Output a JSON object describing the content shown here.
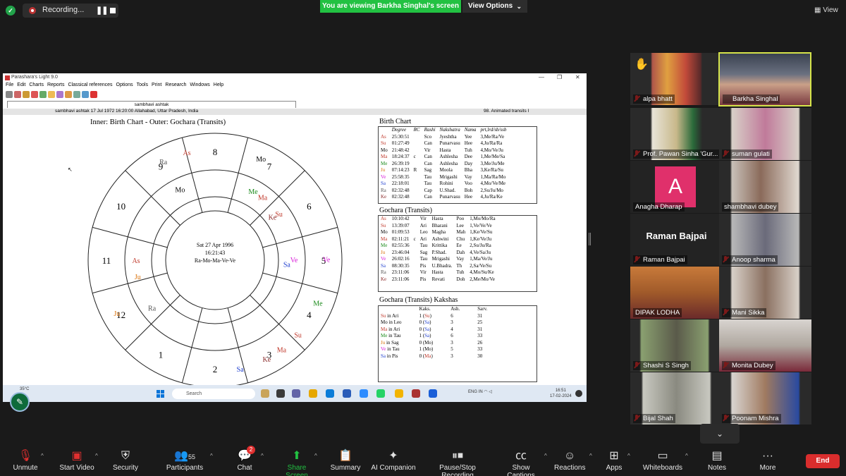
{
  "top": {
    "recording_label": "Recording...",
    "viewing_banner": "You are viewing Barkha Singhal's screen",
    "view_options_label": "View Options",
    "view_label": "View"
  },
  "app": {
    "window_title": "Parashara's Light 9.0",
    "menu": [
      "File",
      "Edit",
      "Charts",
      "Reports",
      "Classical references",
      "Options",
      "Tools",
      "Print",
      "Research",
      "Windows",
      "Help"
    ],
    "tab_label": "sambhavi ashtak",
    "info_left": "sambhavi ashtak 17 Jul 1972 16:20:00  Allahabad, Uttar Pradesh, India",
    "info_right": "98. Animated transits I",
    "chart_title": "Inner: Birth Chart - Outer: Gochara (Transits)",
    "wheel_center": [
      "Sat 27 Apr 1996",
      "16:21:43",
      "Ra-Mo-Ma-Ve-Ve"
    ],
    "house_numbers": [
      "1",
      "2",
      "3",
      "4",
      "5",
      "6",
      "7",
      "8",
      "9",
      "10",
      "11",
      "12"
    ],
    "birth_chart": {
      "title": "Birth Chart",
      "headers": [
        "",
        "Degree",
        "RC",
        "Rashi",
        "Nakshatra",
        "Nama",
        "prt,lrd/sb/ssb"
      ],
      "rows": [
        [
          "As",
          "25:30:51",
          "",
          "Sco",
          "Jyeshtha",
          "Yee",
          "3,Me/Ra/Ve"
        ],
        [
          "Su",
          "01:27:49",
          "",
          "Can",
          "Punarvasu",
          "Hee",
          "4,Ju/Ra/Ra"
        ],
        [
          "Mo",
          "21:48:42",
          "",
          "Vir",
          "Hasta",
          "Tuh",
          "4,Mo/Ve/Ju"
        ],
        [
          "Ma",
          "18:24:37",
          "c",
          "Can",
          "Ashlesha",
          "Dee",
          "1,Me/Me/Sa"
        ],
        [
          "Me",
          "26:39:19",
          "",
          "Can",
          "Ashlesha",
          "Day",
          "3,Me/Ju/Me"
        ],
        [
          "Ju",
          "07:14:23",
          "R",
          "Sag",
          "Moola",
          "Bha",
          "3,Ke/Ra/Su"
        ],
        [
          "Ve",
          "25:58:35",
          "",
          "Tau",
          "Mrigashi",
          "Vay",
          "1,Ma/Ra/Mo"
        ],
        [
          "Sa",
          "22:18:01",
          "",
          "Tau",
          "Rohini",
          "Voo",
          "4,Mo/Ve/Me"
        ],
        [
          "Ra",
          "02:32:48",
          "",
          "Cap",
          "U.Shad.",
          "Boh",
          "2,Su/Ju/Mo"
        ],
        [
          "Ke",
          "02:32:48",
          "",
          "Can",
          "Punarvasu",
          "Hee",
          "4,Ju/Ra/Ke"
        ]
      ]
    },
    "gochara": {
      "title": "Gochara (Transits)",
      "rows": [
        [
          "As",
          "10:10:42",
          "",
          "Vir",
          "Hasta",
          "Poo",
          "1,Mo/Mo/Ra"
        ],
        [
          "Su",
          "13:39:07",
          "",
          "Ari",
          "Bharani",
          "Lee",
          "1,Ve/Ve/Ve"
        ],
        [
          "Mo",
          "01:09:53",
          "",
          "Leo",
          "Magha",
          "Mah",
          "1,Ke/Ve/Su"
        ],
        [
          "Ma",
          "02:11:21",
          "c",
          "Ari",
          "Ashwini",
          "Chu",
          "1,Ke/Ve/Ju"
        ],
        [
          "Me",
          "02:55:36",
          "",
          "Tau",
          "Krittika",
          "Ee",
          "2,Su/Ju/Ra"
        ],
        [
          "Ju",
          "23:46:04",
          "",
          "Sag",
          "P.Shad.",
          "Dah",
          "4,Ve/Sa/Ju"
        ],
        [
          "Ve",
          "26:02:16",
          "",
          "Tau",
          "Mrigashi",
          "Vay",
          "1,Ma/Ve/Ju"
        ],
        [
          "Sa",
          "08:30:35",
          "",
          "Pis",
          "U.Bhadra.",
          "Th",
          "2,Sa/Ve/Su"
        ],
        [
          "Ra",
          "23:11:06",
          "",
          "Vir",
          "Hasta",
          "Tuh",
          "4,Mo/Su/Ke"
        ],
        [
          "Ke",
          "23:11:06",
          "",
          "Pis",
          "Revati",
          "Doh",
          "2,Me/Mo/Ve"
        ]
      ]
    },
    "kakshas": {
      "title": "Gochara (Transits) Kakshas",
      "headers": [
        "",
        "Kaks.",
        "Ash.",
        "Sarv."
      ],
      "rows": [
        [
          "Su",
          "in Ari",
          "1",
          "Su",
          "6",
          "31"
        ],
        [
          "Mo",
          "in Leo",
          "0",
          "Sa",
          "3",
          "25"
        ],
        [
          "Ma",
          "in Ari",
          "0",
          "Sa",
          "4",
          "31"
        ],
        [
          "Me",
          "in Tau",
          "1",
          "Sa",
          "6",
          "33"
        ],
        [
          "Ju",
          "in Sag",
          "0",
          "Mo",
          "3",
          "26"
        ],
        [
          "Ve",
          "in Tau",
          "1",
          "Mo",
          "5",
          "33"
        ],
        [
          "Sa",
          "in Pis",
          "0",
          "Ma",
          "3",
          "30"
        ]
      ]
    },
    "planet_colors": {
      "As": "#c0392b",
      "Su": "#c0392b",
      "Mo": "#000000",
      "Ma": "#c0392b",
      "Me": "#1a8a1a",
      "Ju": "#d9730d",
      "Ve": "#d81bd8",
      "Sa": "#1f3fcf",
      "Ra": "#555555",
      "Ke": "#8b2b2b"
    }
  },
  "taskbar": {
    "weather": "35°C",
    "search_placeholder": "Search",
    "tray_lang": "ENG",
    "tray_region": "IN",
    "time": "16:51",
    "date": "17-02-2024"
  },
  "participants": [
    {
      "name": "alpa bhatt"
    },
    {
      "name": "Barkha Singhal"
    },
    {
      "name": "Prof. Pawan Sinha 'Gur..."
    },
    {
      "name": "suman gulati"
    },
    {
      "name": "Anagha Dharap",
      "initial": "A"
    },
    {
      "name": "shambhavi dubey"
    },
    {
      "name": "Raman Bajpai",
      "card": "Raman Bajpai"
    },
    {
      "name": "Anoop sharma"
    },
    {
      "name": "DIPAK LODHA"
    },
    {
      "name": "Mani Sikka"
    },
    {
      "name": "Shashi S Singh"
    },
    {
      "name": "Monita Dubey"
    },
    {
      "name": "Bijal Shah"
    },
    {
      "name": "Poonam Mishra"
    }
  ],
  "toolbar": {
    "unmute": "Unmute",
    "start_video": "Start Video",
    "security": "Security",
    "participants": "Participants",
    "participants_count": "55",
    "chat": "Chat",
    "chat_badge": "2",
    "share_screen": "Share Screen",
    "summary": "Summary",
    "ai_companion": "AI Companion",
    "pause_recording": "Pause/Stop Recording",
    "show_captions": "Show Captions",
    "reactions": "Reactions",
    "apps": "Apps",
    "whiteboards": "Whiteboards",
    "notes": "Notes",
    "more": "More",
    "end": "End"
  },
  "colors": {
    "accent_green": "#22c142",
    "end_red": "#d92d2d",
    "active_border": "#d5e44a"
  }
}
